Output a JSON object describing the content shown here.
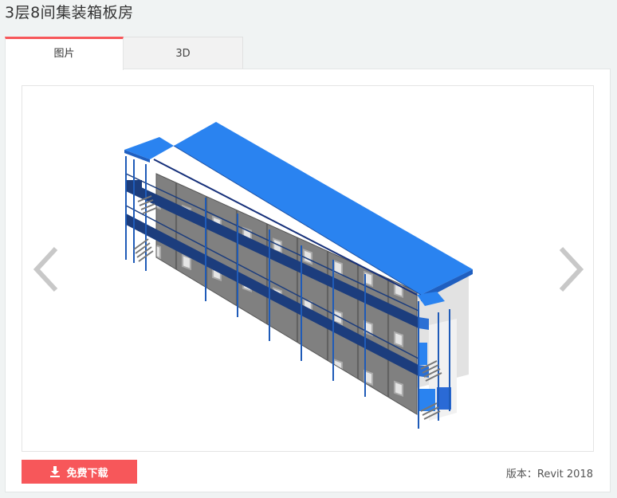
{
  "page": {
    "title": "3层8间集装箱板房"
  },
  "tabs": [
    {
      "label": "图片",
      "active": true
    },
    {
      "label": "3D",
      "active": false
    }
  ],
  "viewer": {
    "prev_icon": "chevron-left-icon",
    "next_icon": "chevron-right-icon",
    "image_subject": "3-storey 8-room container building model",
    "colors": {
      "roof": "#2a83f0",
      "corridor": "#1b3c7a",
      "wall": "#7a7a7a",
      "side": "#e4e4e4"
    }
  },
  "footer": {
    "download_label": "免费下载",
    "download_icon": "download-icon",
    "version_label": "版本：",
    "version_value": "Revit 2018"
  },
  "colors": {
    "accent": "#f7575a",
    "background": "#f0f3f3"
  }
}
